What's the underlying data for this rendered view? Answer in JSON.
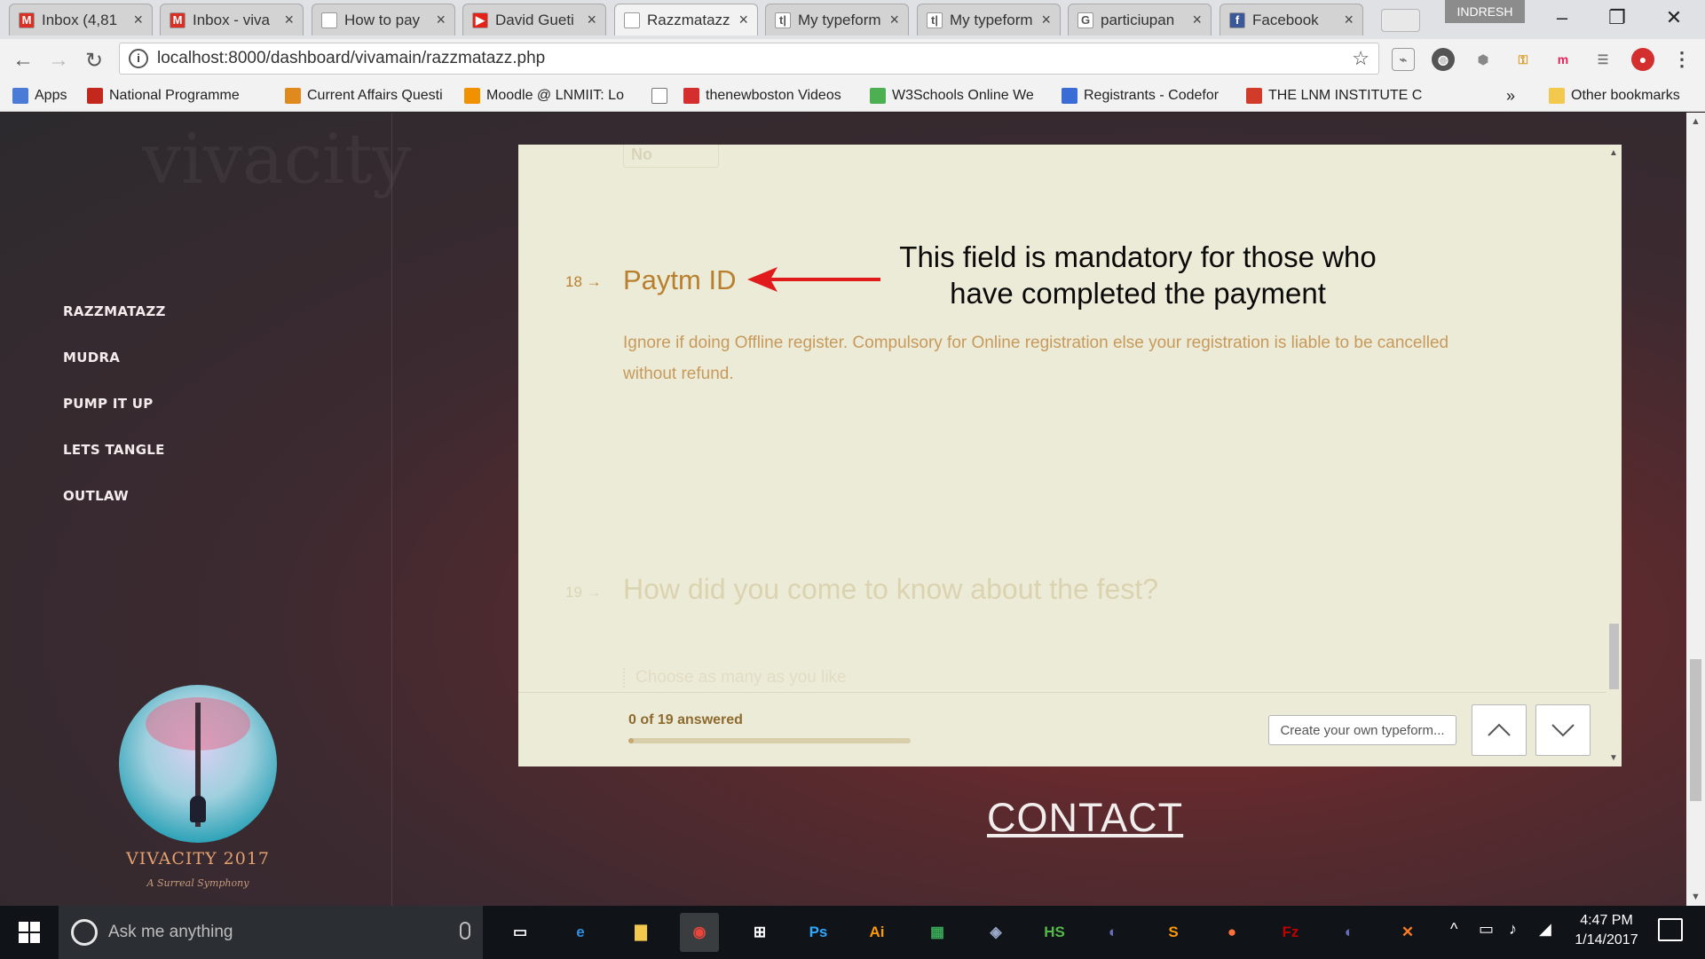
{
  "browser": {
    "tabs": [
      {
        "title": "Inbox (4,81",
        "icon": "gmail-icon",
        "color": "#d93025",
        "glyph": "M"
      },
      {
        "title": "Inbox - viva",
        "icon": "gmail-icon",
        "color": "#d93025",
        "glyph": "M"
      },
      {
        "title": "How to pay",
        "icon": "page-icon",
        "color": "#ffffff",
        "glyph": ""
      },
      {
        "title": "David Gueti",
        "icon": "youtube-icon",
        "color": "#e62117",
        "glyph": "▶"
      },
      {
        "title": "Razzmatazz",
        "icon": "page-icon",
        "color": "#ffffff",
        "glyph": ""
      },
      {
        "title": "My typeform",
        "icon": "typeform-icon",
        "color": "#ffffff",
        "glyph": "t|"
      },
      {
        "title": "My typeform",
        "icon": "typeform-icon",
        "color": "#ffffff",
        "glyph": "t|"
      },
      {
        "title": "particiupan",
        "icon": "google-icon",
        "color": "#ffffff",
        "glyph": "G"
      },
      {
        "title": "Facebook",
        "icon": "facebook-icon",
        "color": "#3b5998",
        "glyph": "f"
      }
    ],
    "profile_name": "INDRESH",
    "url": "localhost:8000/dashboard/vivamain/razzmatazz.php",
    "bookmarks": [
      {
        "label": "Apps",
        "icon": "apps-icon",
        "color": "#4a7bd6"
      },
      {
        "label": "National Programme",
        "icon": "nptel-icon",
        "color": "#c4281c"
      },
      {
        "label": "Current Affairs Questi",
        "icon": "badge-icon",
        "color": "#e08a1e"
      },
      {
        "label": "Moodle @ LNMIIT: Lo",
        "icon": "moodle-icon",
        "color": "#f29100"
      },
      {
        "label": "",
        "icon": "page-icon",
        "color": "#ffffff"
      },
      {
        "label": "thenewboston Videos",
        "icon": "thenewboston-icon",
        "color": "#d42e2e"
      },
      {
        "label": "W3Schools Online We",
        "icon": "w3schools-icon",
        "color": "#4caf50"
      },
      {
        "label": "Registrants - Codefor",
        "icon": "chart-icon",
        "color": "#3b6cd6"
      },
      {
        "label": "THE LNM INSTITUTE C",
        "icon": "lnm-icon",
        "color": "#d23a2a"
      },
      {
        "label": "Other bookmarks",
        "icon": "folder-icon",
        "color": "#f2c94c"
      }
    ],
    "bookmarks_overflow": "»"
  },
  "page": {
    "background_word": "vivacity",
    "sidebar": {
      "items": [
        "RAZZMATAZZ",
        "MUDRA",
        "PUMP IT UP",
        "LETS TANGLE",
        "OUTLAW"
      ]
    },
    "logo": {
      "title": "VIVACITY 2017",
      "subtitle": "A Surreal Symphony"
    },
    "contact_link": "CONTACT"
  },
  "typeform": {
    "previous_answer": "No",
    "q18": {
      "number": "18 →",
      "title": "Paytm ID",
      "description": "Ignore if doing Offline register. Compulsory for Online registration else your registration is liable to be cancelled without refund."
    },
    "annotation": {
      "line1": "This field is mandatory for those who",
      "line2": "have completed the payment",
      "arrow_color": "#e11b1b"
    },
    "q19": {
      "number": "19 →",
      "title": "How did you come to know about the fest?",
      "hint": "Choose as many as you like"
    },
    "footer": {
      "progress_text": "0 of 19 answered",
      "progress_fraction": 0,
      "create_button": "Create your own typeform...",
      "nav_up_icon": "chevron-up-icon",
      "nav_down_icon": "chevron-down-icon"
    }
  },
  "taskbar": {
    "search_placeholder": "Ask me anything",
    "apps": [
      {
        "name": "task-view",
        "glyph": "▭",
        "color": "#ffffff"
      },
      {
        "name": "edge",
        "glyph": "e",
        "color": "#2f8fe0"
      },
      {
        "name": "file-explorer",
        "glyph": "▇",
        "color": "#f2c94c"
      },
      {
        "name": "chrome",
        "glyph": "◉",
        "color": "#e8453c"
      },
      {
        "name": "store",
        "glyph": "⊞",
        "color": "#ffffff"
      },
      {
        "name": "photoshop",
        "glyph": "Ps",
        "color": "#31a8ff"
      },
      {
        "name": "illustrator",
        "glyph": "Ai",
        "color": "#ff9a00"
      },
      {
        "name": "sheets",
        "glyph": "▦",
        "color": "#3aa757"
      },
      {
        "name": "app-circle",
        "glyph": "◈",
        "color": "#9aa8c8"
      },
      {
        "name": "hs-app",
        "glyph": "HS",
        "color": "#54b948"
      },
      {
        "name": "eclipse",
        "glyph": "◐",
        "color": "#6c6cb8"
      },
      {
        "name": "sublime",
        "glyph": "S",
        "color": "#ff9800"
      },
      {
        "name": "firefox",
        "glyph": "●",
        "color": "#ff7139"
      },
      {
        "name": "filezilla",
        "glyph": "Fz",
        "color": "#bf0000"
      },
      {
        "name": "eclipse-2",
        "glyph": "◐",
        "color": "#6c6cb8"
      },
      {
        "name": "xampp",
        "glyph": "✕",
        "color": "#fb7a24"
      }
    ],
    "time": "4:47 PM",
    "date": "1/14/2017"
  }
}
